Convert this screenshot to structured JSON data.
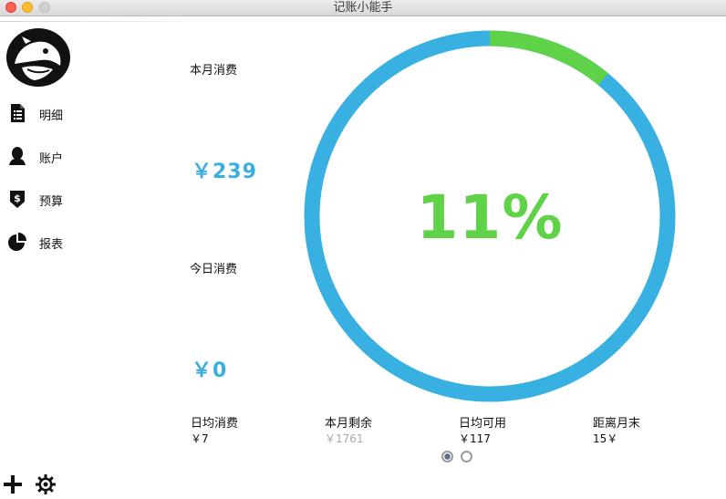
{
  "window": {
    "title": "记账小能手"
  },
  "sidebar": {
    "items": [
      {
        "label": "明细",
        "icon": "document-list-icon"
      },
      {
        "label": "账户",
        "icon": "person-icon"
      },
      {
        "label": "预算",
        "icon": "dollar-shield-icon"
      },
      {
        "label": "报表",
        "icon": "pie-chart-icon"
      }
    ],
    "tools": [
      "add-icon",
      "gear-icon"
    ]
  },
  "stats": {
    "month_label": "本月消费",
    "month_value": "￥239",
    "today_label": "今日消费",
    "today_value": "￥0"
  },
  "ring": {
    "percent_text": "11%",
    "fraction": 0.11,
    "track_color": "#39b0e2",
    "progress_color": "#5fd248"
  },
  "footer": [
    {
      "label": "日均消费",
      "value": "￥7"
    },
    {
      "label": "本月剩余",
      "value": "￥1761"
    },
    {
      "label": "日均可用",
      "value": "￥117"
    },
    {
      "label": "距离月末",
      "value": "15￥"
    }
  ],
  "pager": {
    "pages": 2,
    "active": 0
  }
}
